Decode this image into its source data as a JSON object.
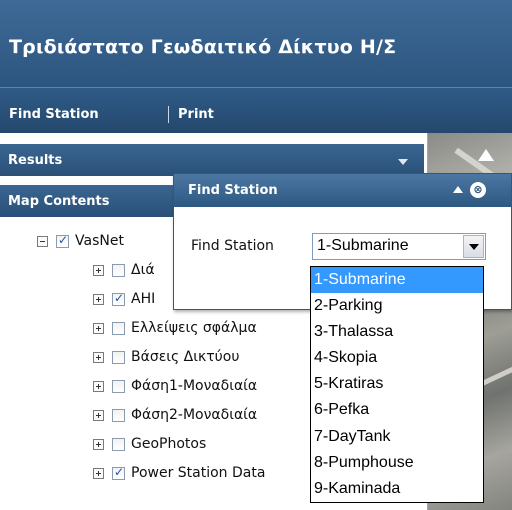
{
  "header": {
    "title": "Τριδιάστατο Γεωδαιτικό Δίκτυο Η/Σ"
  },
  "toolbar": {
    "find_station": "Find Station",
    "print": "Print"
  },
  "panels": {
    "results": "Results",
    "map_contents": "Map Contents"
  },
  "tree": {
    "root": {
      "label": "VasNet",
      "checked": true
    },
    "children": [
      {
        "label": "Διά",
        "checked": false
      },
      {
        "label": "ΑΗΙ",
        "checked": true
      },
      {
        "label": "Ελλείψεις σφάλμα",
        "checked": false
      },
      {
        "label": "Βάσεις Δικτύου",
        "checked": false
      },
      {
        "label": "Φάση1-Μοναδιαία",
        "checked": false
      },
      {
        "label": "Φάση2-Μοναδιαία",
        "checked": false
      },
      {
        "label": "GeoPhotos",
        "checked": false
      },
      {
        "label": "Power Station Data",
        "checked": true
      }
    ]
  },
  "dialog": {
    "title": "Find Station",
    "label": "Find Station",
    "selected_value": "1-Submarine",
    "options": [
      "1-Submarine",
      "2-Parking",
      "3-Thalassa",
      "4-Skopia",
      "5-Kratiras",
      "6-Pefka",
      "7-DayTank",
      "8-Pumphouse",
      "9-Kaminada"
    ],
    "close_glyph": "⊗"
  },
  "colors": {
    "header": "#2c567f",
    "selection": "#3399ff"
  }
}
